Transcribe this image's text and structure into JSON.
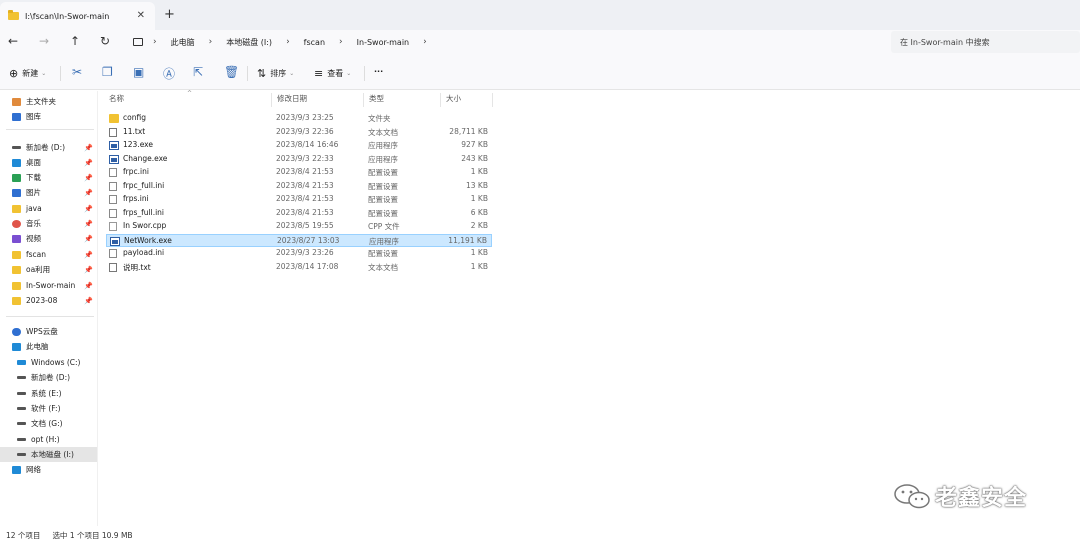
{
  "tab": {
    "title": "I:\\fscan\\In-Swor-main",
    "close_icon": "close-icon",
    "new_tab": "+"
  },
  "address": {
    "breadcrumbs": [
      "此电脑",
      "本地磁盘 (I:)",
      "fscan",
      "In-Swor-main"
    ],
    "search_placeholder": "在 In-Swor-main 中搜索"
  },
  "toolbar": {
    "new_label": "新建",
    "sort_label": "排序",
    "view_label": "查看",
    "more": "···"
  },
  "sidebar": {
    "quick": [
      {
        "label": "主文件夹",
        "icon": "home-icon",
        "color": "#e08a3c"
      },
      {
        "label": "图库",
        "icon": "gallery-icon",
        "color": "#2f6fd1"
      }
    ],
    "pinned": [
      {
        "label": "新加卷 (D:)",
        "icon": "drive-icon",
        "color": "#555555"
      },
      {
        "label": "桌面",
        "icon": "desktop-icon",
        "color": "#1f8ad6"
      },
      {
        "label": "下载",
        "icon": "download-icon",
        "color": "#2aa055"
      },
      {
        "label": "图片",
        "icon": "pictures-icon",
        "color": "#2f6fd1"
      },
      {
        "label": "java",
        "icon": "folder-icon",
        "color": "#f1c232"
      },
      {
        "label": "音乐",
        "icon": "music-icon",
        "color": "#e0554a"
      },
      {
        "label": "视频",
        "icon": "video-icon",
        "color": "#7a4fd1"
      },
      {
        "label": "fscan",
        "icon": "folder-icon",
        "color": "#f1c232"
      },
      {
        "label": "oa利用",
        "icon": "folder-icon",
        "color": "#f1c232"
      },
      {
        "label": "In-Swor-main",
        "icon": "folder-icon",
        "color": "#f1c232"
      },
      {
        "label": "2023-08",
        "icon": "folder-icon",
        "color": "#f1c232"
      }
    ],
    "cloud": {
      "label": "WPS云盘",
      "icon": "cloud-icon",
      "color": "#2f6fd1"
    },
    "pc": {
      "label": "此电脑",
      "icon": "computer-icon",
      "color": "#1f8ad6"
    },
    "drives": [
      {
        "label": "Windows (C:)",
        "icon": "windows-drive-icon"
      },
      {
        "label": "新加卷 (D:)",
        "icon": "drive-icon"
      },
      {
        "label": "系统 (E:)",
        "icon": "drive-icon"
      },
      {
        "label": "软件 (F:)",
        "icon": "drive-icon"
      },
      {
        "label": "文档 (G:)",
        "icon": "drive-icon"
      },
      {
        "label": "opt (H:)",
        "icon": "drive-icon"
      },
      {
        "label": "本地磁盘 (I:)",
        "icon": "drive-icon"
      }
    ],
    "network": {
      "label": "网络",
      "icon": "network-icon",
      "color": "#1f8ad6"
    }
  },
  "columns": {
    "name": "名称",
    "modified": "修改日期",
    "type": "类型",
    "size": "大小"
  },
  "files": [
    {
      "name": "config",
      "modified": "2023/9/3 23:25",
      "type": "文件夹",
      "size": "",
      "kind": "folder"
    },
    {
      "name": "11.txt",
      "modified": "2023/9/3 22:36",
      "type": "文本文档",
      "size": "28,711 KB",
      "kind": "txt"
    },
    {
      "name": "123.exe",
      "modified": "2023/8/14 16:46",
      "type": "应用程序",
      "size": "927 KB",
      "kind": "exe"
    },
    {
      "name": "Change.exe",
      "modified": "2023/9/3 22:33",
      "type": "应用程序",
      "size": "243 KB",
      "kind": "exe"
    },
    {
      "name": "frpc.ini",
      "modified": "2023/8/4 21:53",
      "type": "配置设置",
      "size": "1 KB",
      "kind": "ini"
    },
    {
      "name": "frpc_full.ini",
      "modified": "2023/8/4 21:53",
      "type": "配置设置",
      "size": "13 KB",
      "kind": "ini"
    },
    {
      "name": "frps.ini",
      "modified": "2023/8/4 21:53",
      "type": "配置设置",
      "size": "1 KB",
      "kind": "ini"
    },
    {
      "name": "frps_full.ini",
      "modified": "2023/8/4 21:53",
      "type": "配置设置",
      "size": "6 KB",
      "kind": "ini"
    },
    {
      "name": "In Swor.cpp",
      "modified": "2023/8/5 19:55",
      "type": "CPP 文件",
      "size": "2 KB",
      "kind": "cpp"
    },
    {
      "name": "NetWork.exe",
      "modified": "2023/8/27 13:03",
      "type": "应用程序",
      "size": "11,191 KB",
      "kind": "exe",
      "selected": true
    },
    {
      "name": "payload.ini",
      "modified": "2023/9/3 23:26",
      "type": "配置设置",
      "size": "1 KB",
      "kind": "ini"
    },
    {
      "name": "说明.txt",
      "modified": "2023/8/14 17:08",
      "type": "文本文档",
      "size": "1 KB",
      "kind": "txt"
    }
  ],
  "status": {
    "count": "12 个项目",
    "selection": "选中 1 个项目  10.9 MB"
  },
  "watermark": {
    "text": "老鑫安全",
    "icon": "wechat-logo-icon"
  }
}
